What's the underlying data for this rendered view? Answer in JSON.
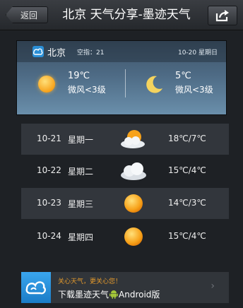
{
  "header": {
    "back_label": "返回",
    "title": "北京 天气分享-墨迹天气",
    "share_icon": "share-icon"
  },
  "today": {
    "city": "北京",
    "aqi": "空指：21",
    "date": "10-20 星期日",
    "day": {
      "icon": "sun-icon",
      "temp": "19℃",
      "wind": "微风<3级"
    },
    "night": {
      "icon": "moon-icon",
      "temp": "5℃",
      "wind": "微风<3级"
    }
  },
  "forecast": [
    {
      "date": "10-21",
      "weekday": "星期一",
      "icon": "partly-cloudy-icon",
      "temp": "18℃/7℃"
    },
    {
      "date": "10-22",
      "weekday": "星期二",
      "icon": "cloudy-icon",
      "temp": "15℃/4℃"
    },
    {
      "date": "10-23",
      "weekday": "星期三",
      "icon": "sun-icon",
      "temp": "14℃/3℃"
    },
    {
      "date": "10-24",
      "weekday": "星期四",
      "icon": "sun-icon",
      "temp": "15℃/4℃"
    }
  ],
  "banner": {
    "slogan": "关心天气，更关心您！",
    "download_prefix": "下载墨迹天气",
    "download_suffix": "Android版",
    "arrow": "›"
  },
  "colors": {
    "background": "#1e2125",
    "card_top": "#3f5367",
    "card_bottom": "#6a8fab",
    "sun": "#f7a21a",
    "slogan": "#e59a2c",
    "android_green": "#a4c639"
  }
}
